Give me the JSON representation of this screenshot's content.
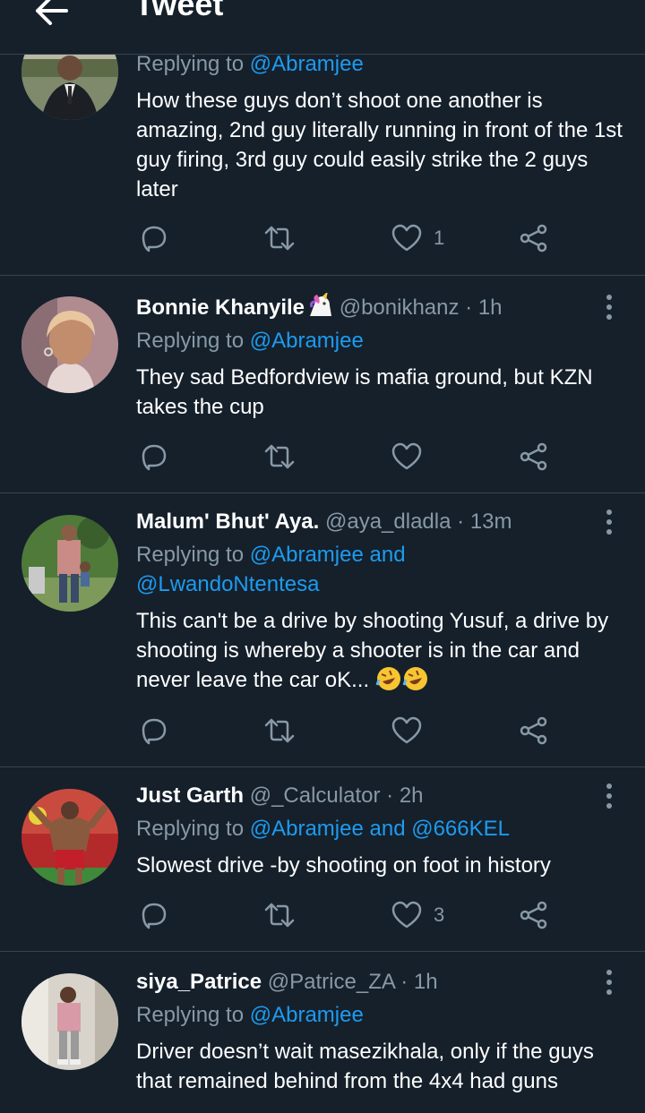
{
  "header": {
    "title": "Tweet"
  },
  "icons": {
    "back": "arrow-left-icon",
    "more": "more-vertical-icon",
    "reply": "reply-icon",
    "retweet": "retweet-icon",
    "like": "heart-icon",
    "share": "share-icon"
  },
  "colors": {
    "background": "#15202b",
    "accent": "#1d9bf0",
    "muted": "#8899a6",
    "divider": "#38444d"
  },
  "tweets": [
    {
      "reply_prefix": "Replying to",
      "mentions": "@Abramjee",
      "text": "How these guys don’t shoot one another is amazing, 2nd guy literally running in front of the 1st guy firing, 3rd guy could easily strike the 2 guys later",
      "likes": "1"
    },
    {
      "name": "Bonnie Khanyile",
      "handle": "@bonikhanz",
      "separator": "·",
      "time": "1h",
      "reply_prefix": "Replying to",
      "mentions": "@Abramjee",
      "text": "They sad Bedfordview is mafia ground, but KZN takes the cup",
      "likes": ""
    },
    {
      "name": "Malum' Bhut' Aya.",
      "handle": "@aya_dladla",
      "separator": "·",
      "time": "13m",
      "reply_prefix": "Replying to",
      "mentions": "@Abramjee and",
      "mentions2": "@LwandoNtentesa",
      "text": "This can't be a drive by shooting Yusuf, a drive by shooting is whereby a shooter is in the car and never leave the car oK...",
      "likes": ""
    },
    {
      "name": "Just Garth",
      "handle": "@_Calculator",
      "separator": "·",
      "time": "2h",
      "reply_prefix": "Replying to",
      "mentions": "@Abramjee and @666KEL",
      "text": "Slowest drive -by shooting on foot in history",
      "likes": "3"
    },
    {
      "name": "siya_Patrice",
      "handle": "@Patrice_ZA",
      "separator": "·",
      "time": "1h",
      "reply_prefix": "Replying to",
      "mentions": "@Abramjee",
      "text": "Driver doesn’t wait masezikhala, only if the guys that remained behind from the 4x4 had guns",
      "likes": ""
    }
  ]
}
